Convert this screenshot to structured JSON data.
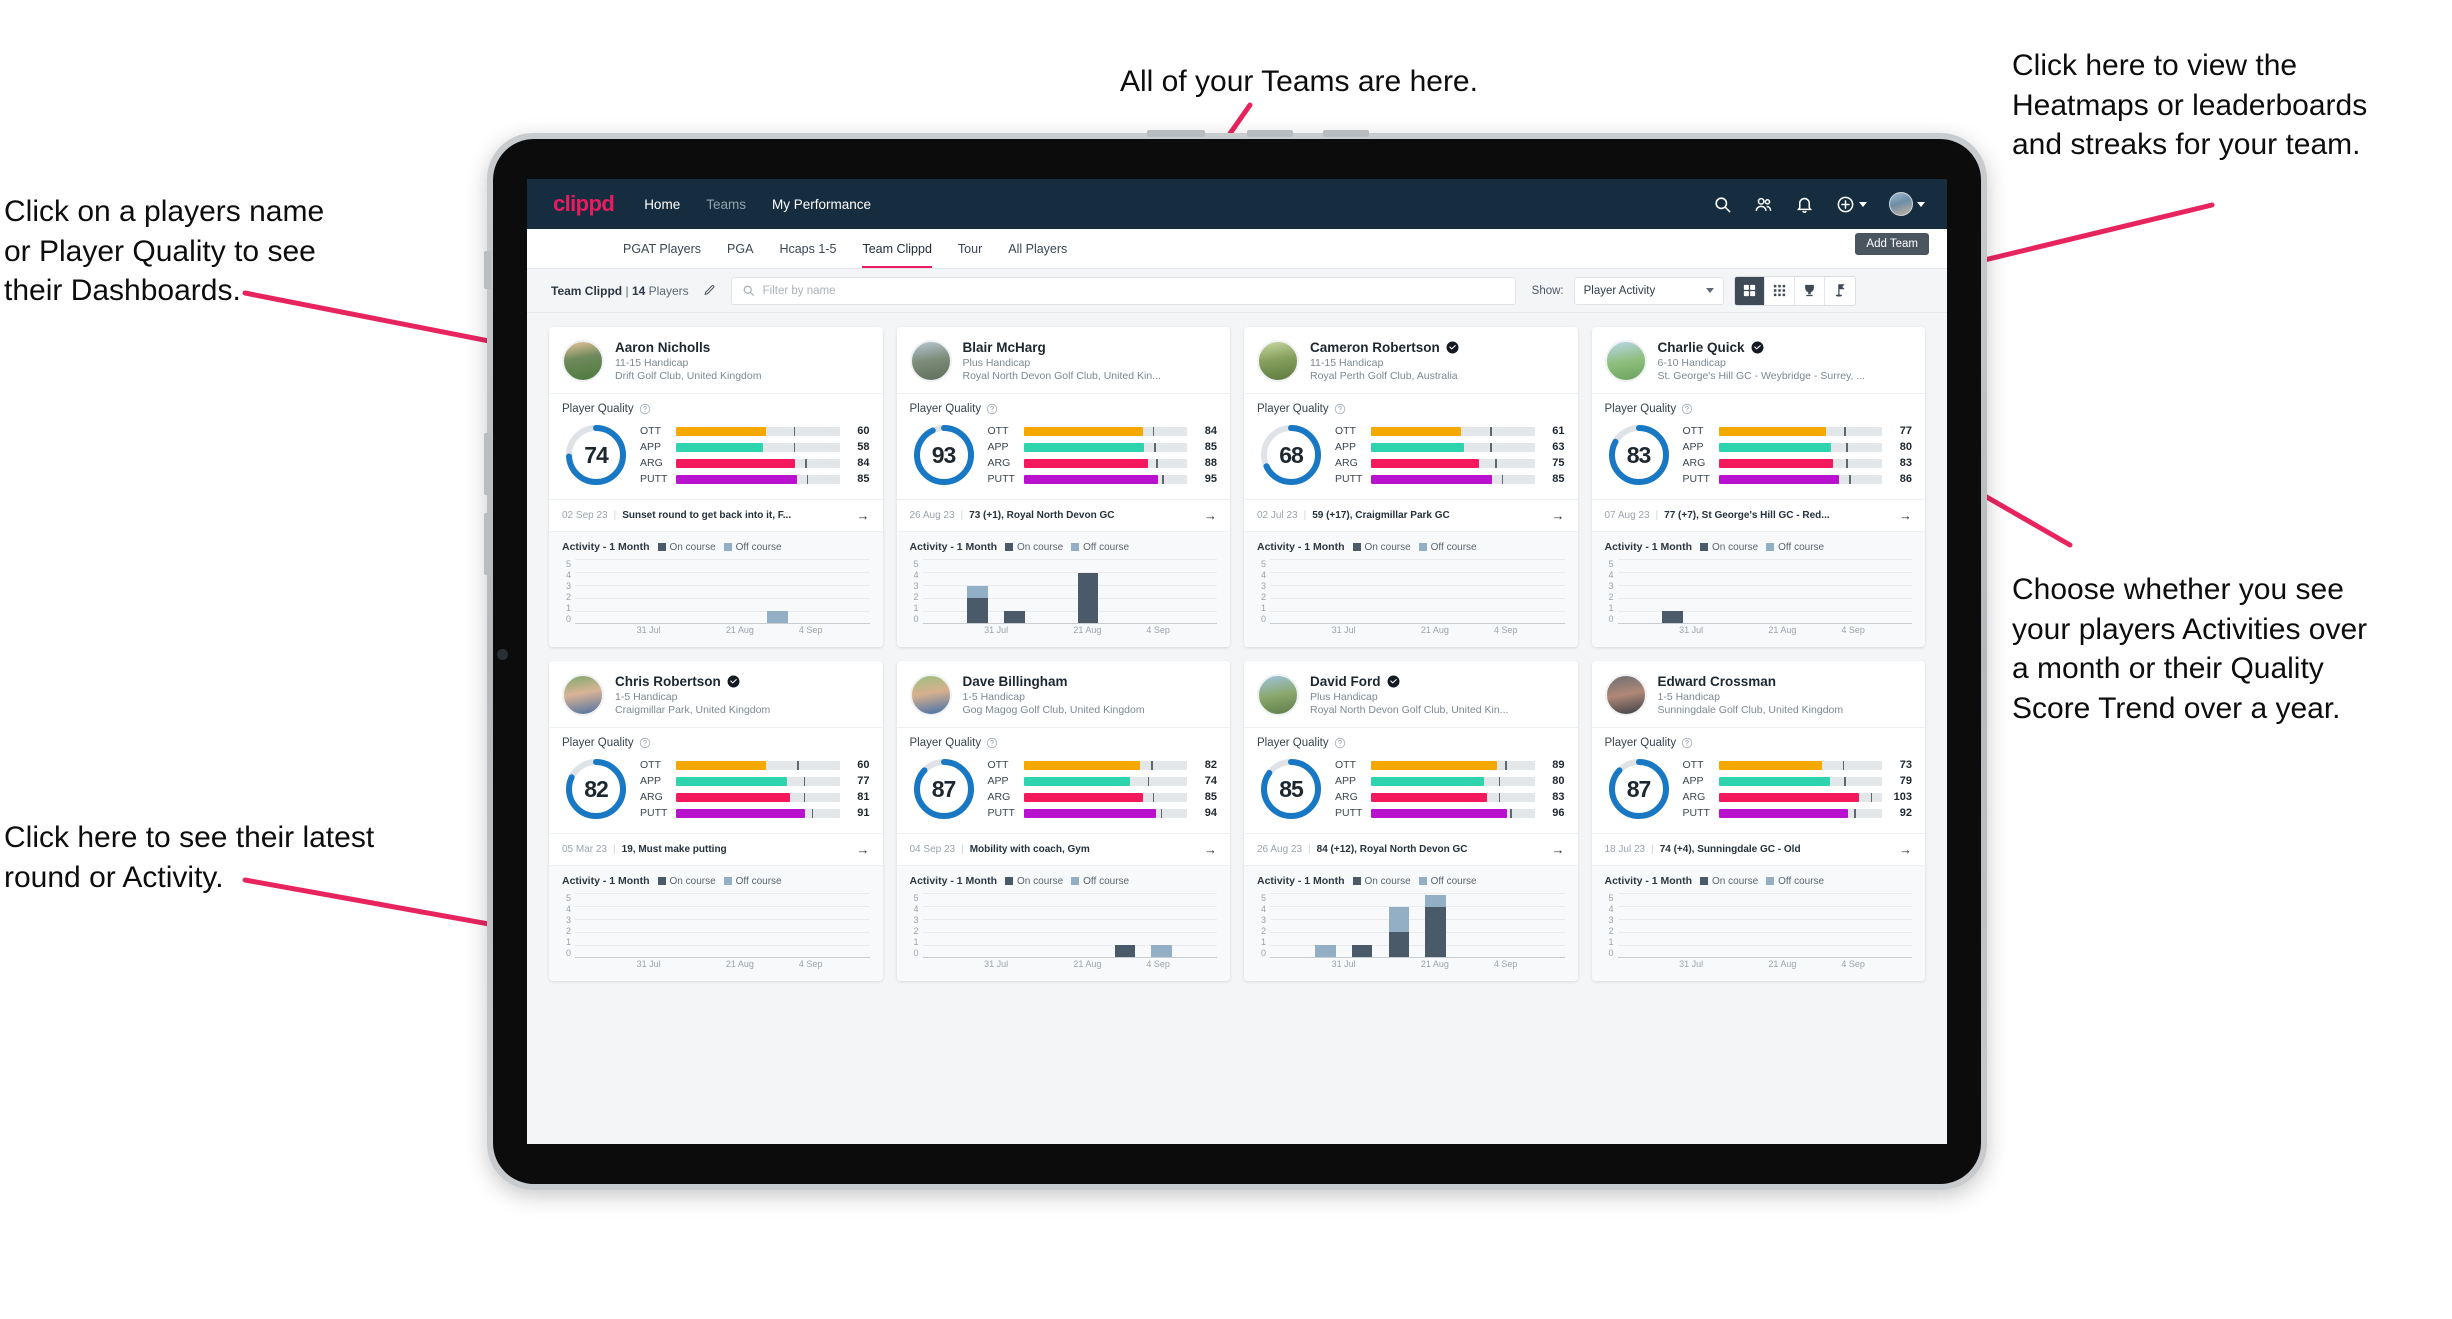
{
  "annotations": {
    "left_top": "Click on a players name\nor Player Quality to see\ntheir Dashboards.",
    "left_bottom": "Click here to see their latest\nround or Activity.",
    "top": "All of your Teams are here.",
    "right_top": "Click here to view the\nHeatmaps or leaderboards\nand streaks for your team.",
    "right_bottom": "Choose whether you see\nyour players Activities over\na month or their Quality\nScore Trend over a year.",
    "arrow_color": "#e8245f"
  },
  "header": {
    "brand": "clippd",
    "nav": [
      {
        "label": "Home",
        "active": true
      },
      {
        "label": "Teams",
        "active": false
      },
      {
        "label": "My Performance",
        "active": true
      }
    ],
    "icons": [
      "search-icon",
      "people-icon",
      "bell-icon",
      "plus-circle-icon",
      "avatar"
    ]
  },
  "tabbar": {
    "tabs": [
      {
        "label": "PGAT Players",
        "active": false
      },
      {
        "label": "PGA",
        "active": false
      },
      {
        "label": "Hcaps 1-5",
        "active": false
      },
      {
        "label": "Team Clippd",
        "active": true
      },
      {
        "label": "Tour",
        "active": false
      },
      {
        "label": "All Players",
        "active": false
      }
    ],
    "add_team_label": "Add Team"
  },
  "filterbar": {
    "team_name": "Team Clippd",
    "separator": "|",
    "player_count": "14",
    "players_word": "Players",
    "edit_icon": "pencil-icon",
    "search_placeholder": "Filter by name",
    "search_value": "",
    "show_label": "Show:",
    "show_value": "Player Activity",
    "show_options": [
      "Player Activity",
      "Quality Score Trend"
    ],
    "view_modes": [
      {
        "name": "grid-view-icon",
        "active": true
      },
      {
        "name": "dense-grid-view-icon",
        "active": false
      },
      {
        "name": "trophy-leaderboard-icon",
        "active": false
      },
      {
        "name": "flagstick-heatmap-icon",
        "active": false
      }
    ]
  },
  "card_labels": {
    "player_quality": "Player Quality",
    "activity": "Activity - 1 Month",
    "legend_on": "On course",
    "legend_off": "Off course",
    "arrow": "→",
    "help_icon": "question-circle-icon"
  },
  "metric_colors": {
    "OTT": "#f5a800",
    "APP": "#2ed4ae",
    "ARG": "#f4195c",
    "PUTT": "#b812cf",
    "donut": "#1878c4",
    "donut_track": "#dfe3e7"
  },
  "chart_axis": {
    "yticks": [
      "5",
      "4",
      "3",
      "2",
      "1",
      "0"
    ],
    "ymax": 5,
    "xticks": [
      "31 Jul",
      "21 Aug",
      "4 Sep"
    ],
    "slots": 8
  },
  "players": [
    {
      "name": "Aaron Nicholls",
      "verified": false,
      "handicap": "11-15 Handicap",
      "club": "Drift Golf Club, United Kingdom",
      "quality": 74,
      "metrics": [
        {
          "label": "OTT",
          "value": 60,
          "fill": 55,
          "tick": 72
        },
        {
          "label": "APP",
          "value": 58,
          "fill": 53,
          "tick": 72
        },
        {
          "label": "ARG",
          "value": 84,
          "fill": 73,
          "tick": 79
        },
        {
          "label": "PUTT",
          "value": 85,
          "fill": 74,
          "tick": 80
        }
      ],
      "latest_date": "02 Sep 23",
      "latest_text": "Sunset round to get back into it, F...",
      "activity": [
        {
          "slot": 5,
          "on": 0,
          "off": 1
        }
      ]
    },
    {
      "name": "Blair McHarg",
      "verified": false,
      "handicap": "Plus Handicap",
      "club": "Royal North Devon Golf Club, United Kin...",
      "quality": 93,
      "metrics": [
        {
          "label": "OTT",
          "value": 84,
          "fill": 73,
          "tick": 79
        },
        {
          "label": "APP",
          "value": 85,
          "fill": 74,
          "tick": 80
        },
        {
          "label": "ARG",
          "value": 88,
          "fill": 76,
          "tick": 81
        },
        {
          "label": "PUTT",
          "value": 95,
          "fill": 82,
          "tick": 85
        }
      ],
      "latest_date": "26 Aug 23",
      "latest_text": "73 (+1), Royal North Devon GC",
      "activity": [
        {
          "slot": 1,
          "on": 2,
          "off": 1
        },
        {
          "slot": 2,
          "on": 1,
          "off": 0
        },
        {
          "slot": 4,
          "on": 4,
          "off": 0
        }
      ]
    },
    {
      "name": "Cameron Robertson",
      "verified": true,
      "handicap": "11-15 Handicap",
      "club": "Royal Perth Golf Club, Australia",
      "quality": 68,
      "metrics": [
        {
          "label": "OTT",
          "value": 61,
          "fill": 55,
          "tick": 73
        },
        {
          "label": "APP",
          "value": 63,
          "fill": 57,
          "tick": 73
        },
        {
          "label": "ARG",
          "value": 75,
          "fill": 66,
          "tick": 76
        },
        {
          "label": "PUTT",
          "value": 85,
          "fill": 74,
          "tick": 80
        }
      ],
      "latest_date": "02 Jul 23",
      "latest_text": "59 (+17), Craigmillar Park GC",
      "activity": []
    },
    {
      "name": "Charlie Quick",
      "verified": true,
      "handicap": "6-10 Handicap",
      "club": "St. George's Hill GC - Weybridge - Surrey, ...",
      "quality": 83,
      "metrics": [
        {
          "label": "OTT",
          "value": 77,
          "fill": 66,
          "tick": 77
        },
        {
          "label": "APP",
          "value": 80,
          "fill": 69,
          "tick": 78
        },
        {
          "label": "ARG",
          "value": 83,
          "fill": 70,
          "tick": 78
        },
        {
          "label": "PUTT",
          "value": 86,
          "fill": 74,
          "tick": 80
        }
      ],
      "latest_date": "07 Aug 23",
      "latest_text": "77 (+7), St George's Hill GC - Red...",
      "activity": [
        {
          "slot": 1,
          "on": 1,
          "off": 0
        }
      ]
    },
    {
      "name": "Chris Robertson",
      "verified": true,
      "handicap": "1-5 Handicap",
      "club": "Craigmillar Park, United Kingdom",
      "quality": 82,
      "metrics": [
        {
          "label": "OTT",
          "value": 60,
          "fill": 55,
          "tick": 74
        },
        {
          "label": "APP",
          "value": 77,
          "fill": 68,
          "tick": 78
        },
        {
          "label": "ARG",
          "value": 81,
          "fill": 70,
          "tick": 78
        },
        {
          "label": "PUTT",
          "value": 91,
          "fill": 79,
          "tick": 83
        }
      ],
      "latest_date": "05 Mar 23",
      "latest_text": "19, Must make putting",
      "activity": []
    },
    {
      "name": "Dave Billingham",
      "verified": false,
      "handicap": "1-5 Handicap",
      "club": "Gog Magog Golf Club, United Kingdom",
      "quality": 87,
      "metrics": [
        {
          "label": "OTT",
          "value": 82,
          "fill": 71,
          "tick": 78
        },
        {
          "label": "APP",
          "value": 74,
          "fill": 65,
          "tick": 76
        },
        {
          "label": "ARG",
          "value": 85,
          "fill": 73,
          "tick": 79
        },
        {
          "label": "PUTT",
          "value": 94,
          "fill": 81,
          "tick": 84
        }
      ],
      "latest_date": "04 Sep 23",
      "latest_text": "Mobility with coach, Gym",
      "activity": [
        {
          "slot": 5,
          "on": 1,
          "off": 0
        },
        {
          "slot": 6,
          "on": 0,
          "off": 1
        }
      ]
    },
    {
      "name": "David Ford",
      "verified": true,
      "handicap": "Plus Handicap",
      "club": "Royal North Devon Golf Club, United Kin...",
      "quality": 85,
      "metrics": [
        {
          "label": "OTT",
          "value": 89,
          "fill": 77,
          "tick": 82
        },
        {
          "label": "APP",
          "value": 80,
          "fill": 69,
          "tick": 78
        },
        {
          "label": "ARG",
          "value": 83,
          "fill": 71,
          "tick": 78
        },
        {
          "label": "PUTT",
          "value": 96,
          "fill": 83,
          "tick": 85
        }
      ],
      "latest_date": "26 Aug 23",
      "latest_text": "84 (+12), Royal North Devon GC",
      "activity": [
        {
          "slot": 1,
          "on": 0,
          "off": 1
        },
        {
          "slot": 2,
          "on": 1,
          "off": 0
        },
        {
          "slot": 3,
          "on": 2,
          "off": 2
        },
        {
          "slot": 4,
          "on": 4,
          "off": 1
        }
      ]
    },
    {
      "name": "Edward Crossman",
      "verified": false,
      "handicap": "1-5 Handicap",
      "club": "Sunningdale Golf Club, United Kingdom",
      "quality": 87,
      "metrics": [
        {
          "label": "OTT",
          "value": 73,
          "fill": 63,
          "tick": 76
        },
        {
          "label": "APP",
          "value": 79,
          "fill": 68,
          "tick": 77
        },
        {
          "label": "ARG",
          "value": 103,
          "fill": 86,
          "tick": 93
        },
        {
          "label": "PUTT",
          "value": 92,
          "fill": 79,
          "tick": 83
        }
      ],
      "latest_date": "18 Jul 23",
      "latest_text": "74 (+4), Sunningdale GC - Old",
      "activity": []
    }
  ]
}
